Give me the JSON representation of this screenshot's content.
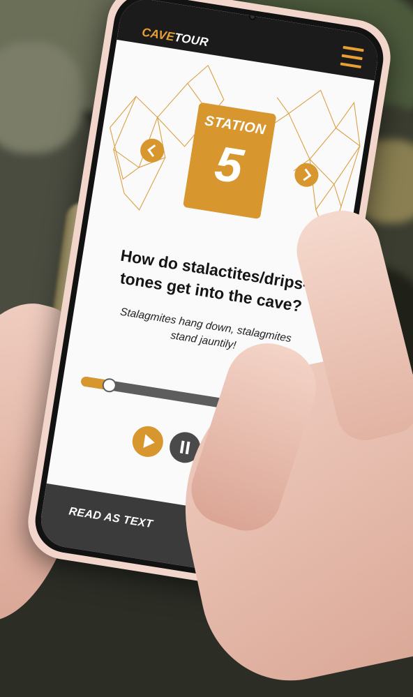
{
  "app": {
    "brand_part1": "CAVE",
    "brand_part2": "TOUR",
    "menu_icon": "hamburger-icon"
  },
  "station": {
    "label": "STATION",
    "number": "5",
    "prev_icon": "chevron-left-icon",
    "next_icon": "chevron-right-icon"
  },
  "content": {
    "question": "How do stalactites/drips-tones get into the cave?",
    "answer": "Stalagmites hang down, stalagmites stand jauntily!"
  },
  "player": {
    "progress_fraction": 0.13,
    "play_icon": "play-icon",
    "pause_icon": "pause-icon"
  },
  "footer": {
    "read_as_text": "READ AS TEXT"
  },
  "colors": {
    "accent": "#d8962e",
    "topbar": "#1b1b1b",
    "panel": "#3b3b3b"
  }
}
